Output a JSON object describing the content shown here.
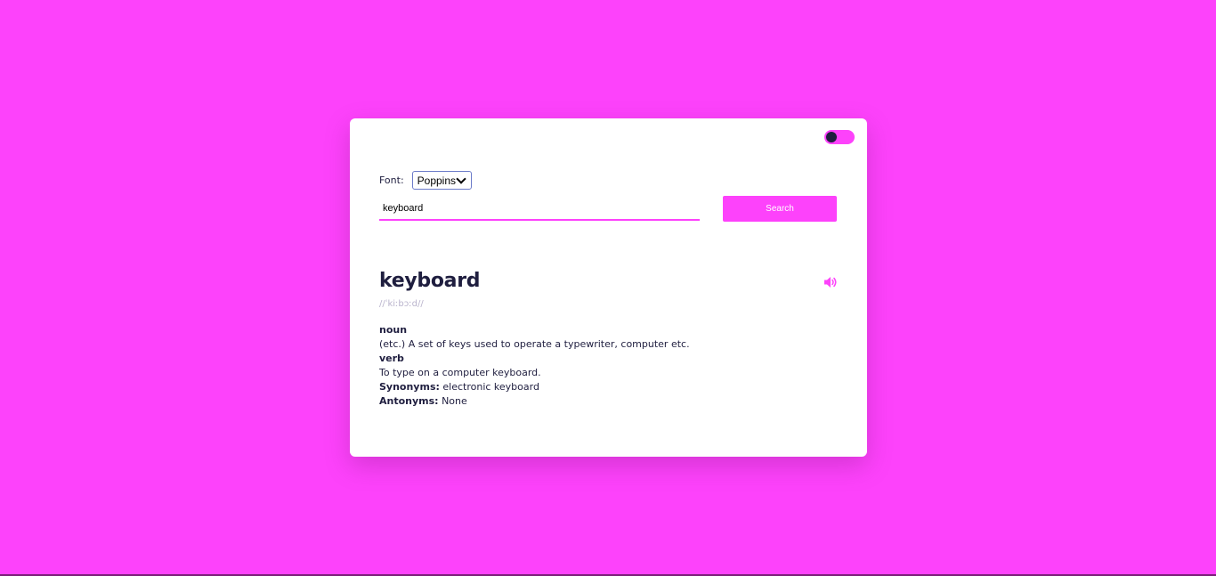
{
  "theme_toggle": {
    "state": "dark-off"
  },
  "font_selector": {
    "label": "Font:",
    "selected": "Poppins"
  },
  "search": {
    "value": "keyboard",
    "button_label": "Search"
  },
  "result": {
    "word": "keyboard",
    "phonetic": "//ˈkiːbɔːd//",
    "meanings": [
      {
        "part_of_speech": "noun",
        "definition": "(etc.) A set of keys used to operate a typewriter, computer etc."
      },
      {
        "part_of_speech": "verb",
        "definition": "To type on a computer keyboard."
      }
    ],
    "synonyms_label": "Synonyms:",
    "synonyms": "electronic keyboard",
    "antonyms_label": "Antonyms:",
    "antonyms": "None"
  },
  "colors": {
    "background": "#fd42fb",
    "accent": "#fd42fb",
    "text": "#1f1e3f",
    "card": "#ffffff"
  }
}
